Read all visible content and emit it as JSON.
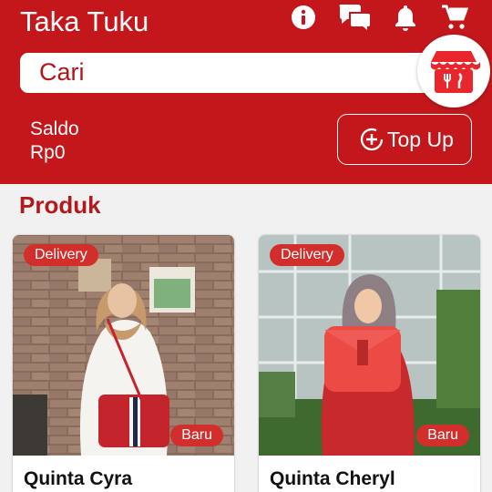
{
  "app": {
    "title": "Taka Tuku"
  },
  "header_icons": [
    "info-icon",
    "chat-icon",
    "bell-icon",
    "cart-icon"
  ],
  "search": {
    "placeholder": "Cari"
  },
  "shop_button": {
    "icon": "store-food-icon"
  },
  "balance": {
    "label": "Saldo",
    "value": "Rp0"
  },
  "topup": {
    "label": "Top Up",
    "icon": "plus-circle-icon"
  },
  "section": {
    "title": "Produk"
  },
  "products": [
    {
      "name": "Quinta Cyra",
      "tag": "Delivery",
      "badge": "Baru"
    },
    {
      "name": "Quinta Cheryl",
      "tag": "Delivery",
      "badge": "Baru"
    }
  ],
  "colors": {
    "primary": "#c3171b",
    "badge": "#d22f2c",
    "title_text": "#b3191c"
  }
}
